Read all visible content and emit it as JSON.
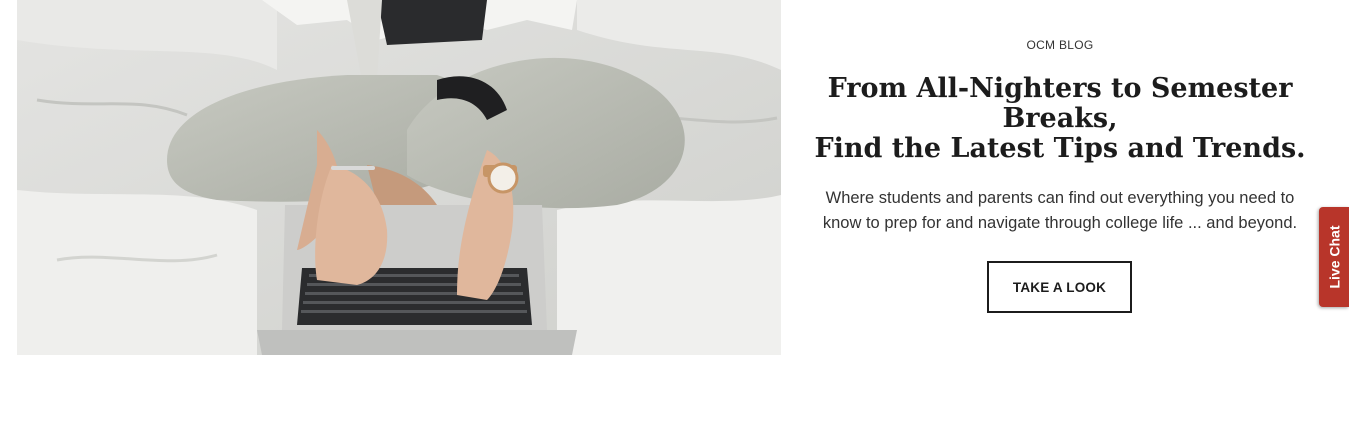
{
  "hero": {
    "image_alt": "Person sitting cross-legged on a bed typing on a laptop"
  },
  "blog": {
    "eyebrow": "OCM BLOG",
    "headline_lines": [
      "From All-Nighters to Semester",
      "Breaks,",
      "Find the Latest Tips and Trends."
    ],
    "intro_lines": [
      "Where students and parents can find out everything you need to",
      "know to prep for and navigate through college life ... and beyond."
    ],
    "cta_label": "TAKE A LOOK"
  },
  "live_chat": {
    "label": "Live Chat",
    "color": "#b8352a"
  }
}
